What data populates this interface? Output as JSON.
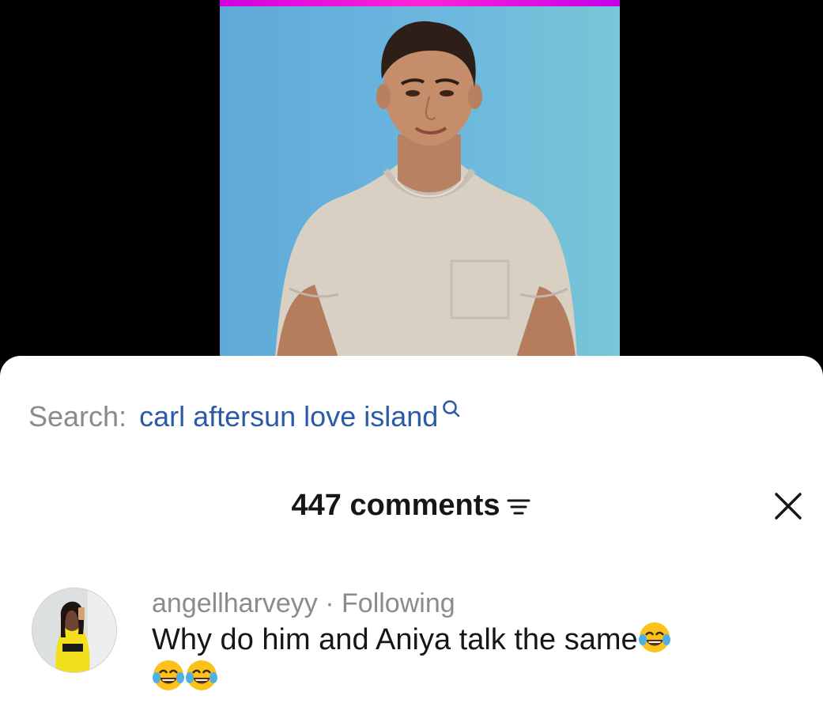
{
  "search": {
    "label": "Search:",
    "query": "carl aftersun love island"
  },
  "comments_header": {
    "count_label": "447 comments"
  },
  "comment": {
    "username": "angellharveyy",
    "separator": " · ",
    "status": "Following",
    "text": "Why do him and Aniya talk the same"
  },
  "icons": {
    "search": "search-icon",
    "sort": "sort-icon",
    "close": "close-icon",
    "emoji": "face-with-tears-of-joy-emoji"
  },
  "colors": {
    "query_link": "#2b5aa6",
    "video_bar": "#e210e0",
    "muted_text": "#8a8a8a"
  }
}
